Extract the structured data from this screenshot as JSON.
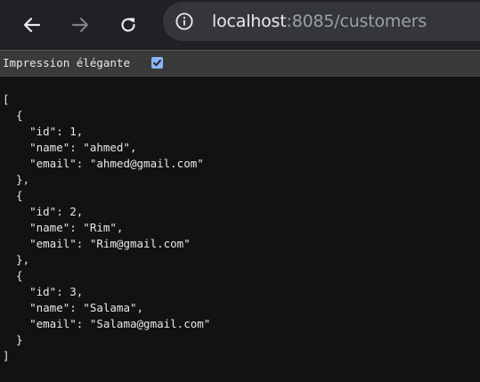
{
  "browser": {
    "back_icon": "arrow-left-icon",
    "forward_icon": "arrow-right-icon",
    "reload_icon": "reload-icon",
    "site_info_icon": "info-icon",
    "url_host": "localhost",
    "url_rest": ":8085/customers"
  },
  "pretty_print": {
    "label": "Impression élégante",
    "checked": true
  },
  "json_lines": [
    "[",
    "  {",
    "    \"id\": 1,",
    "    \"name\": \"ahmed\",",
    "    \"email\": \"ahmed@gmail.com\"",
    "  },",
    "  {",
    "    \"id\": 2,",
    "    \"name\": \"Rim\",",
    "    \"email\": \"Rim@gmail.com\"",
    "  },",
    "  {",
    "    \"id\": 3,",
    "    \"name\": \"Salama\",",
    "    \"email\": \"Salama@gmail.com\"",
    "  }",
    "]"
  ]
}
